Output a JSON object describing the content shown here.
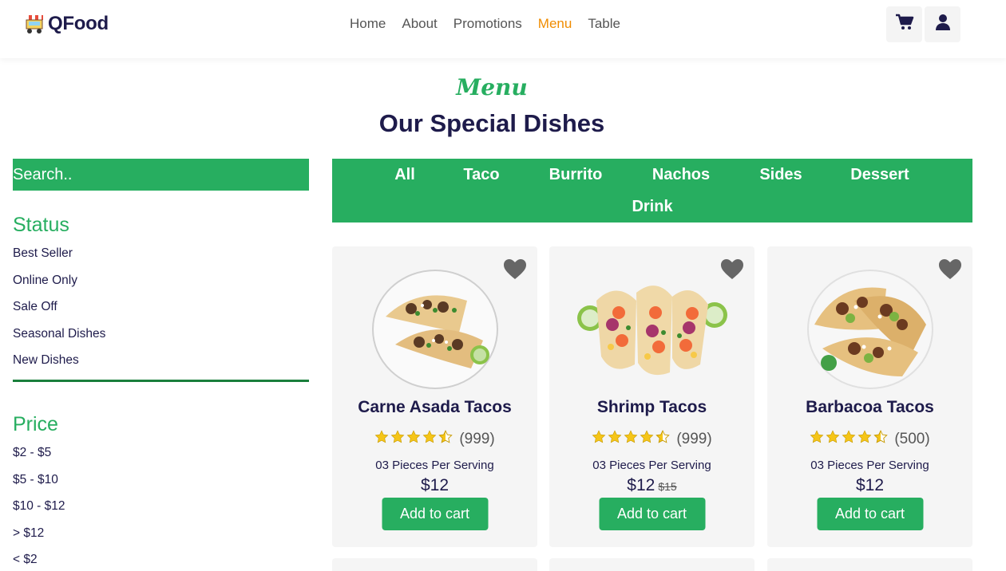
{
  "brand": {
    "name": "QFood",
    "icon": "food-cart-icon"
  },
  "nav": [
    {
      "label": "Home",
      "active": false
    },
    {
      "label": "About",
      "active": false
    },
    {
      "label": "Promotions",
      "active": false
    },
    {
      "label": "Menu",
      "active": true
    },
    {
      "label": "Table",
      "active": false
    }
  ],
  "header_actions": {
    "cart_icon": "cart-icon",
    "user_icon": "user-icon"
  },
  "section": {
    "eyebrow": "Menu",
    "title": "Our Special Dishes"
  },
  "search": {
    "placeholder": "Search.."
  },
  "filters": {
    "status": {
      "heading": "Status",
      "items": [
        "Best Seller",
        "Online Only",
        "Sale Off",
        "Seasonal Dishes",
        "New Dishes"
      ]
    },
    "price": {
      "heading": "Price",
      "items": [
        "$2 - $5",
        "$5 - $10",
        "$10 - $12",
        "> $12",
        "< $2"
      ]
    }
  },
  "categories": [
    "All",
    "Taco",
    "Burrito",
    "Nachos",
    "Sides",
    "Dessert",
    "Drink"
  ],
  "products": [
    {
      "name": "Carne Asada Tacos",
      "rating": 4.5,
      "reviews": "(999)",
      "serving": "03 Pieces Per Serving",
      "price": "$12",
      "old_price": "",
      "button": "Add to cart"
    },
    {
      "name": "Shrimp Tacos",
      "rating": 4.5,
      "reviews": "(999)",
      "serving": "03 Pieces Per Serving",
      "price": "$12",
      "old_price": "$15",
      "button": "Add to cart"
    },
    {
      "name": "Barbacoa Tacos",
      "rating": 4.5,
      "reviews": "(500)",
      "serving": "03 Pieces Per Serving",
      "price": "$12",
      "old_price": "",
      "button": "Add to cart"
    }
  ],
  "colors": {
    "accent": "#27ae60",
    "nav_active": "#f08c00",
    "heading": "#1e1b4b",
    "star": "#f5c518",
    "heart": "#666666"
  }
}
